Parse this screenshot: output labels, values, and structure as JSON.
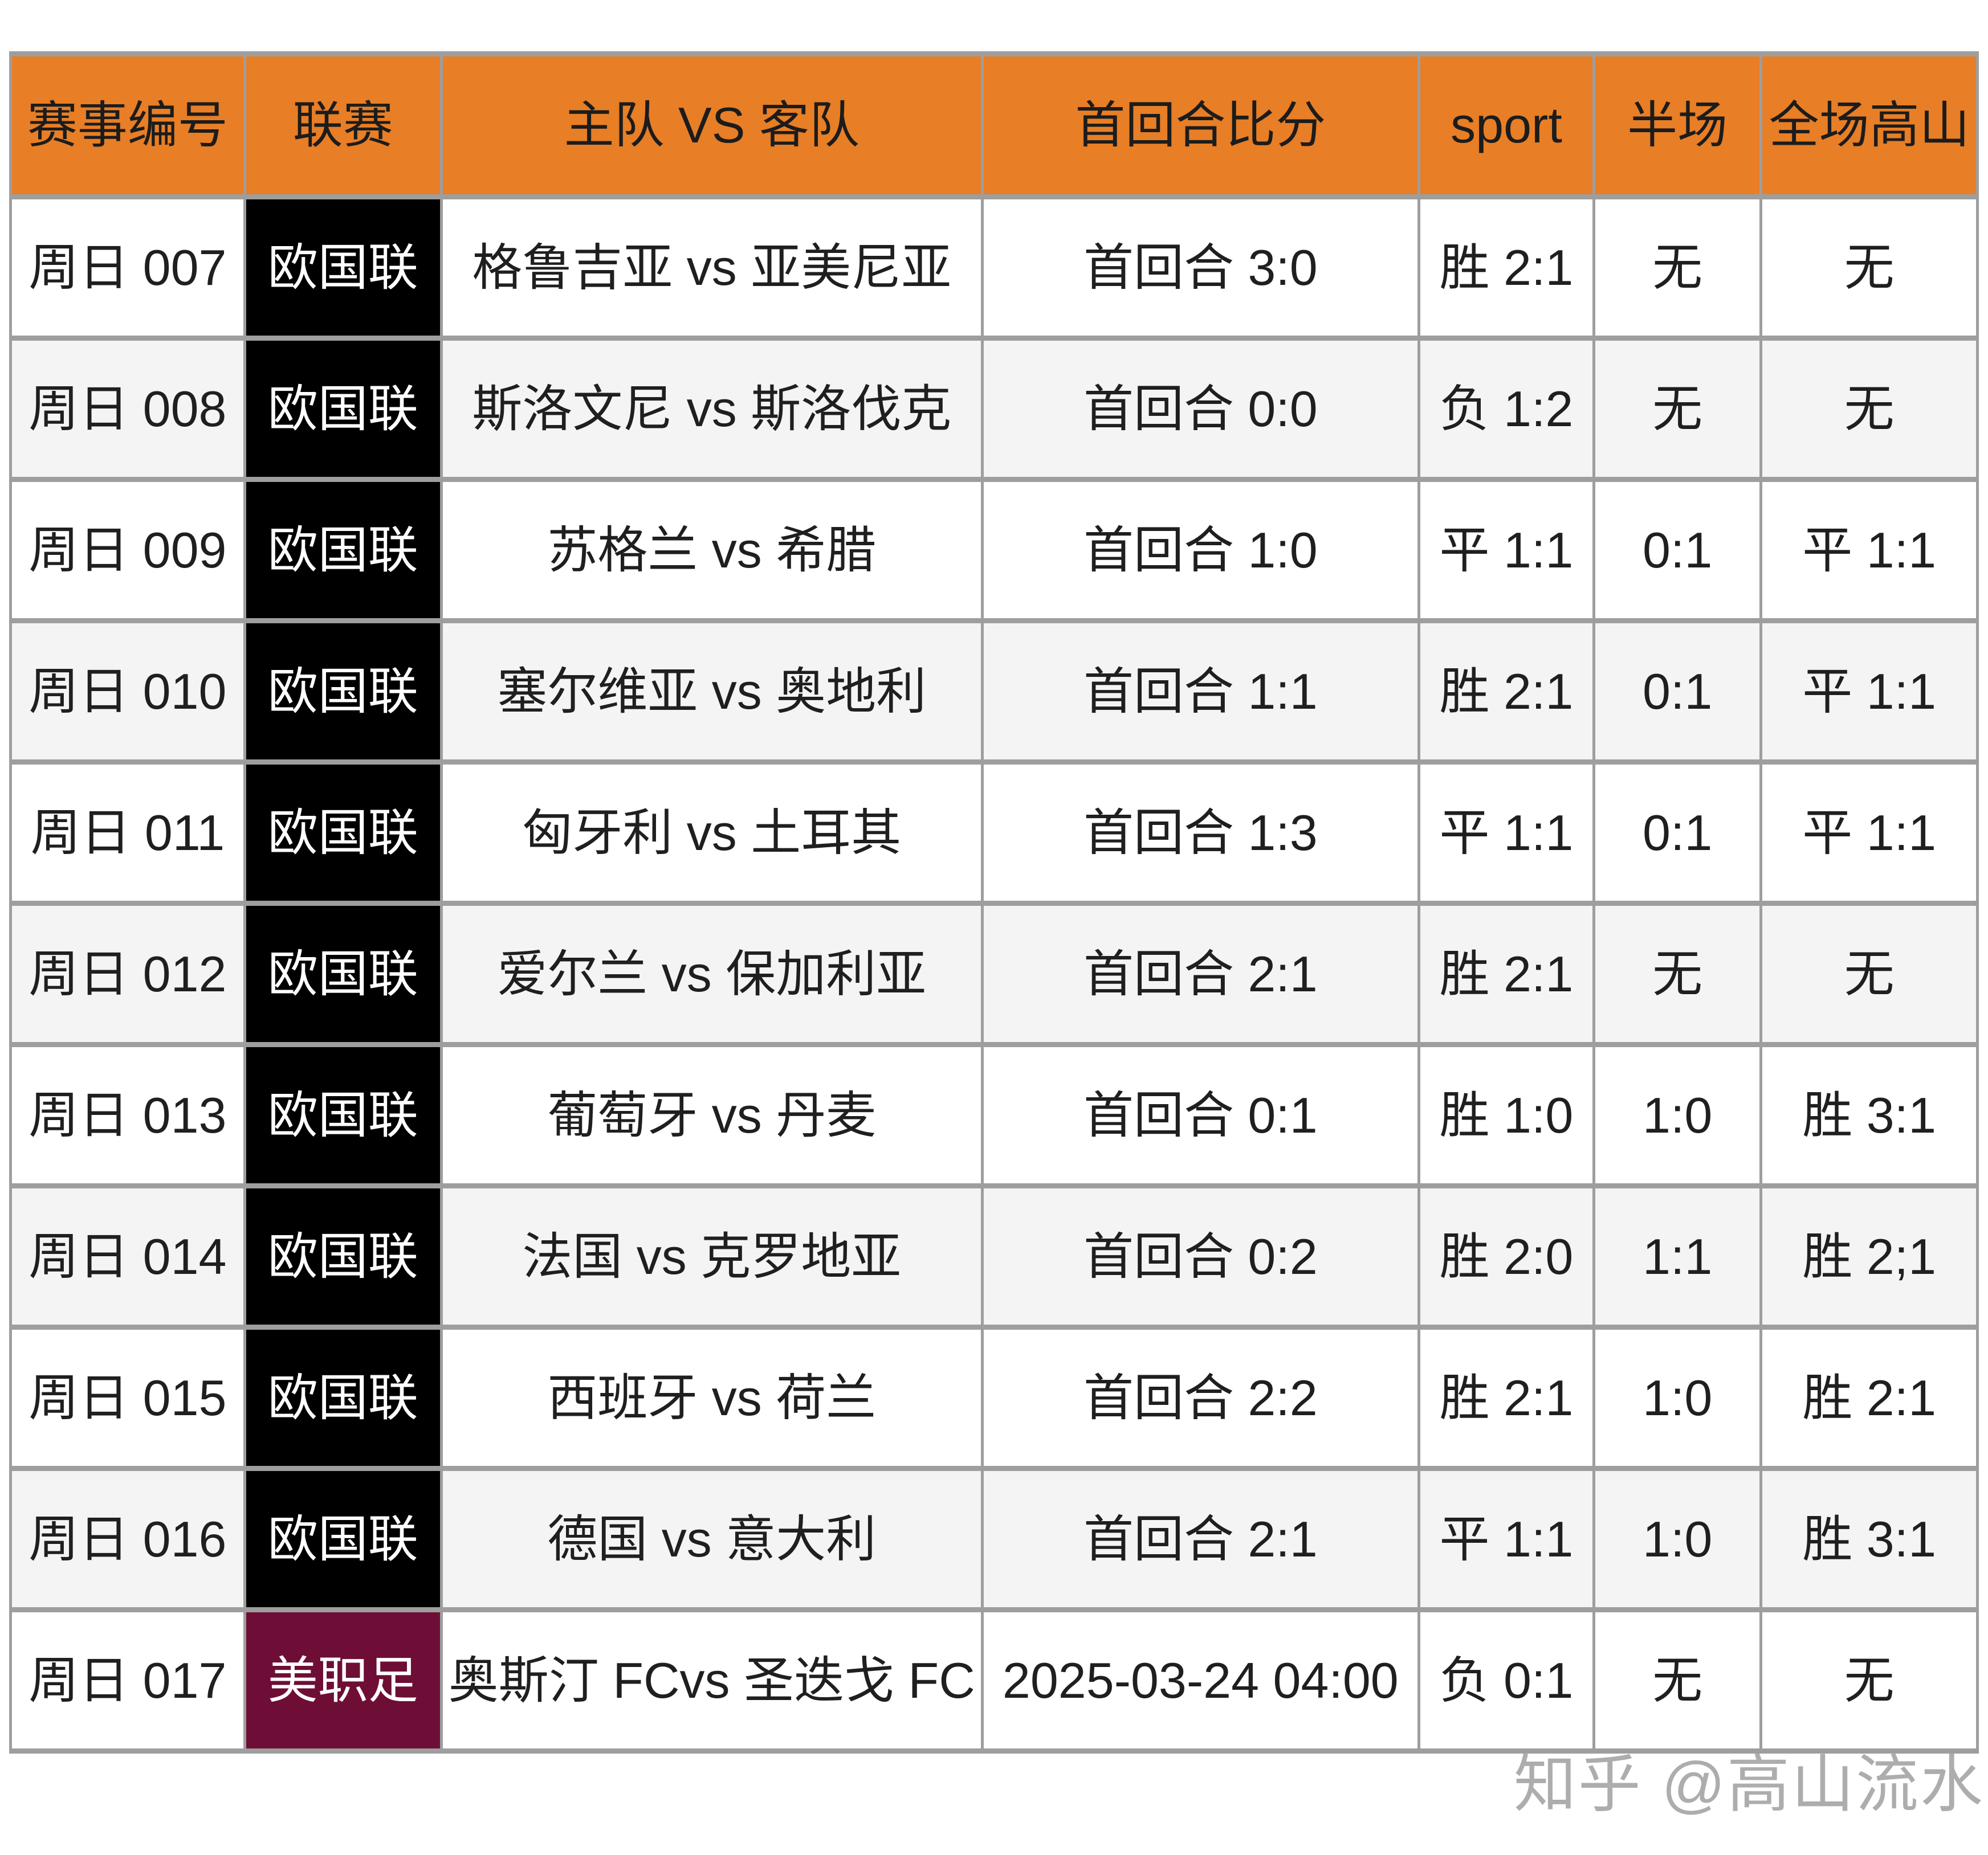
{
  "chart_data": {
    "type": "table",
    "title": "",
    "columns": [
      "赛事编号",
      "联赛",
      "主队 VS 客队",
      "首回合比分",
      "sport",
      "半场",
      "全场高山"
    ],
    "rows": [
      {
        "match_no": "周日 007",
        "league": "欧国联",
        "league_style": "black",
        "teams": "格鲁吉亚 vs 亚美尼亚",
        "first_leg": "首回合 3:0",
        "sport": "胜 2:1",
        "half": "无",
        "full": "无",
        "stripe": "white"
      },
      {
        "match_no": "周日 008",
        "league": "欧国联",
        "league_style": "black",
        "teams": "斯洛文尼 vs 斯洛伐克",
        "first_leg": "首回合 0:0",
        "sport": "负 1:2",
        "half": "无",
        "full": "无",
        "stripe": "gray"
      },
      {
        "match_no": "周日 009",
        "league": "欧国联",
        "league_style": "black",
        "teams": "苏格兰 vs 希腊",
        "first_leg": "首回合 1:0",
        "sport": "平 1:1",
        "half": "0:1",
        "full": "平 1:1",
        "stripe": "white"
      },
      {
        "match_no": "周日 010",
        "league": "欧国联",
        "league_style": "black",
        "teams": "塞尔维亚 vs 奥地利",
        "first_leg": "首回合 1:1",
        "sport": "胜 2:1",
        "half": "0:1",
        "full": "平 1:1",
        "stripe": "gray"
      },
      {
        "match_no": "周日 011",
        "league": "欧国联",
        "league_style": "black",
        "teams": "匈牙利 vs 土耳其",
        "first_leg": "首回合 1:3",
        "sport": "平 1:1",
        "half": "0:1",
        "full": "平 1:1",
        "stripe": "white"
      },
      {
        "match_no": "周日 012",
        "league": "欧国联",
        "league_style": "black",
        "teams": "爱尔兰 vs 保加利亚",
        "first_leg": "首回合 2:1",
        "sport": "胜 2:1",
        "half": "无",
        "full": "无",
        "stripe": "gray"
      },
      {
        "match_no": "周日 013",
        "league": "欧国联",
        "league_style": "black",
        "teams": "葡萄牙 vs 丹麦",
        "first_leg": "首回合 0:1",
        "sport": "胜 1:0",
        "half": "1:0",
        "full": "胜 3:1",
        "stripe": "white"
      },
      {
        "match_no": "周日 014",
        "league": "欧国联",
        "league_style": "black",
        "teams": "法国 vs 克罗地亚",
        "first_leg": "首回合 0:2",
        "sport": "胜 2:0",
        "half": "1:1",
        "full": "胜 2;1",
        "stripe": "gray"
      },
      {
        "match_no": "周日 015",
        "league": "欧国联",
        "league_style": "black",
        "teams": "西班牙 vs 荷兰",
        "first_leg": "首回合 2:2",
        "sport": "胜 2:1",
        "half": "1:0",
        "full": "胜 2:1",
        "stripe": "white"
      },
      {
        "match_no": "周日 016",
        "league": "欧国联",
        "league_style": "black",
        "teams": "德国 vs 意大利",
        "first_leg": "首回合 2:1",
        "sport": "平 1:1",
        "half": "1:0",
        "full": "胜 3:1",
        "stripe": "gray"
      },
      {
        "match_no": "周日 017",
        "league": "美职足",
        "league_style": "maroon",
        "teams": "奥斯汀 FCvs 圣迭戈 FC",
        "first_leg": "2025-03-24 04:00",
        "sport": "负 0:1",
        "half": "无",
        "full": "无",
        "stripe": "white"
      }
    ]
  },
  "watermark": "知乎 @高山流水",
  "colors": {
    "header_bg": "#E87E25",
    "header_text": "#1C1C1C",
    "body_text": "#1F1F1F",
    "border": "#9E9E9E",
    "row_white": "#FFFFFF",
    "row_gray": "#F4F4F5",
    "league_black": "#000000",
    "league_maroon": "#6E0E36",
    "league_text": "#FFFFFF",
    "watermark_text": "#969696"
  }
}
